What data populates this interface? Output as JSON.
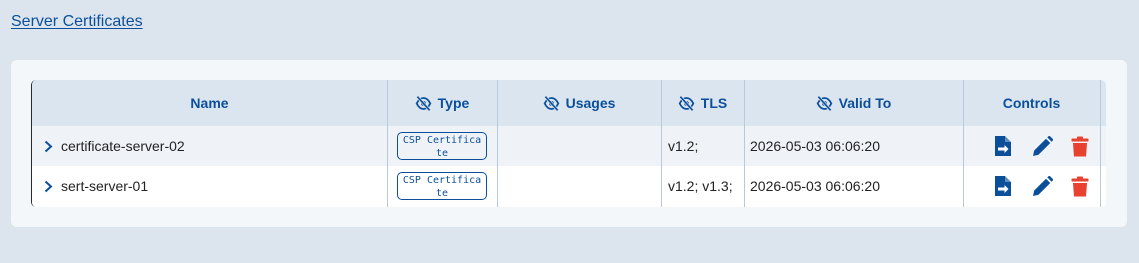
{
  "page": {
    "title": "Server Certificates"
  },
  "table": {
    "columns": {
      "name": "Name",
      "type": "Type",
      "usages": "Usages",
      "tls": "TLS",
      "valid_to": "Valid To",
      "controls": "Controls"
    },
    "rows": [
      {
        "name": "certificate-server-02",
        "type": "CSP Certificate",
        "usages": "",
        "tls": "v1.2;",
        "valid_to": "2026-05-03 06:06:20"
      },
      {
        "name": "sert-server-01",
        "type": "CSP Certificate",
        "usages": "",
        "tls": "v1.2; v1.3;",
        "valid_to": "2026-05-03 06:06:20"
      }
    ]
  },
  "icons": {
    "column_hidden": "eye-slash-icon",
    "expand": "chevron-right-icon",
    "export": "file-export-icon",
    "edit": "pencil-icon",
    "delete": "trash-icon"
  },
  "colors": {
    "accent": "#0b4f9b",
    "delete": "#e8412f",
    "header_bg": "#dbe5f0",
    "page_bg": "#dce4ee"
  }
}
